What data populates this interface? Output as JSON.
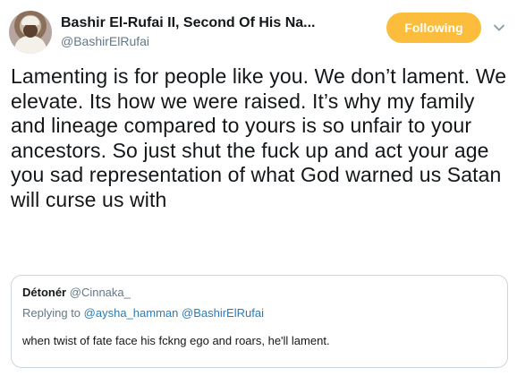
{
  "header": {
    "display_name": "Bashir El-Rufai II, Second Of His Na...",
    "handle": "@BashirElRufai",
    "follow_label": "Following"
  },
  "tweet": {
    "text": "Lamenting is for people like you. We don’t lament. We elevate. Its how we were raised. It’s why my family and lineage compared to yours is so unfair to your ancestors. So just shut the fuck up and act your age you sad representation of what God warned us Satan will curse us with"
  },
  "quote": {
    "name": "Détonér",
    "handle": "@Cinnaka_",
    "replying_prefix": "Replying to",
    "replying_to": [
      "@aysha_hamman",
      "@BashirElRufai"
    ],
    "text": "when twist of fate face his fckng ego and roars, he'll lament."
  },
  "icons": {
    "avatar": "profile-photo",
    "caret": "chevron-down-icon"
  },
  "colors": {
    "follow_button": "#fbbd3b",
    "link": "#2b7bb9",
    "secondary_text": "#657786"
  }
}
